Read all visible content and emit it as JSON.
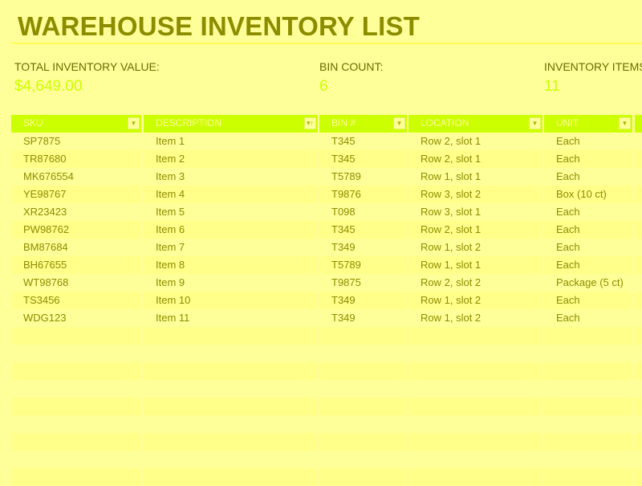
{
  "page": {
    "title": "WAREHOUSE INVENTORY LIST"
  },
  "stats": {
    "total_value_label": "TOTAL INVENTORY VALUE:",
    "total_value": "$4,649.00",
    "bin_count_label": "BIN COUNT:",
    "bin_count": "6",
    "items_label": "INVENTORY ITEMS:",
    "items": "11"
  },
  "colors": {
    "background": "#ffff99",
    "header_bg": "#ccff00",
    "title_text": "#8c8c00",
    "value_text": "#ccff00",
    "row_stripe": "#ffff8a"
  },
  "table": {
    "columns": [
      {
        "label": "SKU",
        "filter_icon": "dropdown-arrow"
      },
      {
        "label": "DESCRIPTION",
        "filter_icon": "sort-ascending"
      },
      {
        "label": "BIN #",
        "filter_icon": "dropdown-arrow"
      },
      {
        "label": "LOCATION",
        "filter_icon": "dropdown-arrow"
      },
      {
        "label": "UNIT",
        "filter_icon": "dropdown-arrow"
      }
    ],
    "rows": [
      [
        "SP7875",
        "Item 1",
        "T345",
        "Row 2, slot 1",
        "Each"
      ],
      [
        "TR87680",
        "Item 2",
        "T345",
        "Row 2, slot 1",
        "Each"
      ],
      [
        "MK676554",
        "Item 3",
        "T5789",
        "Row 1, slot 1",
        "Each"
      ],
      [
        "YE98767",
        "Item 4",
        "T9876",
        "Row 3, slot 2",
        "Box (10 ct)"
      ],
      [
        "XR23423",
        "Item 5",
        "T098",
        "Row 3, slot 1",
        "Each"
      ],
      [
        "PW98762",
        "Item 6",
        "T345",
        "Row 2, slot 1",
        "Each"
      ],
      [
        "BM87684",
        "Item 7",
        "T349",
        "Row 1, slot 2",
        "Each"
      ],
      [
        "BH67655",
        "Item 8",
        "T5789",
        "Row 1, slot 1",
        "Each"
      ],
      [
        "WT98768",
        "Item 9",
        "T9875",
        "Row 2, slot 2",
        "Package (5 ct)"
      ],
      [
        "TS3456",
        "Item 10",
        "T349",
        "Row 1, slot 2",
        "Each"
      ],
      [
        "WDG123",
        "Item 11",
        "T349",
        "Row 1, slot 2",
        "Each"
      ]
    ],
    "empty_rows": 9
  }
}
